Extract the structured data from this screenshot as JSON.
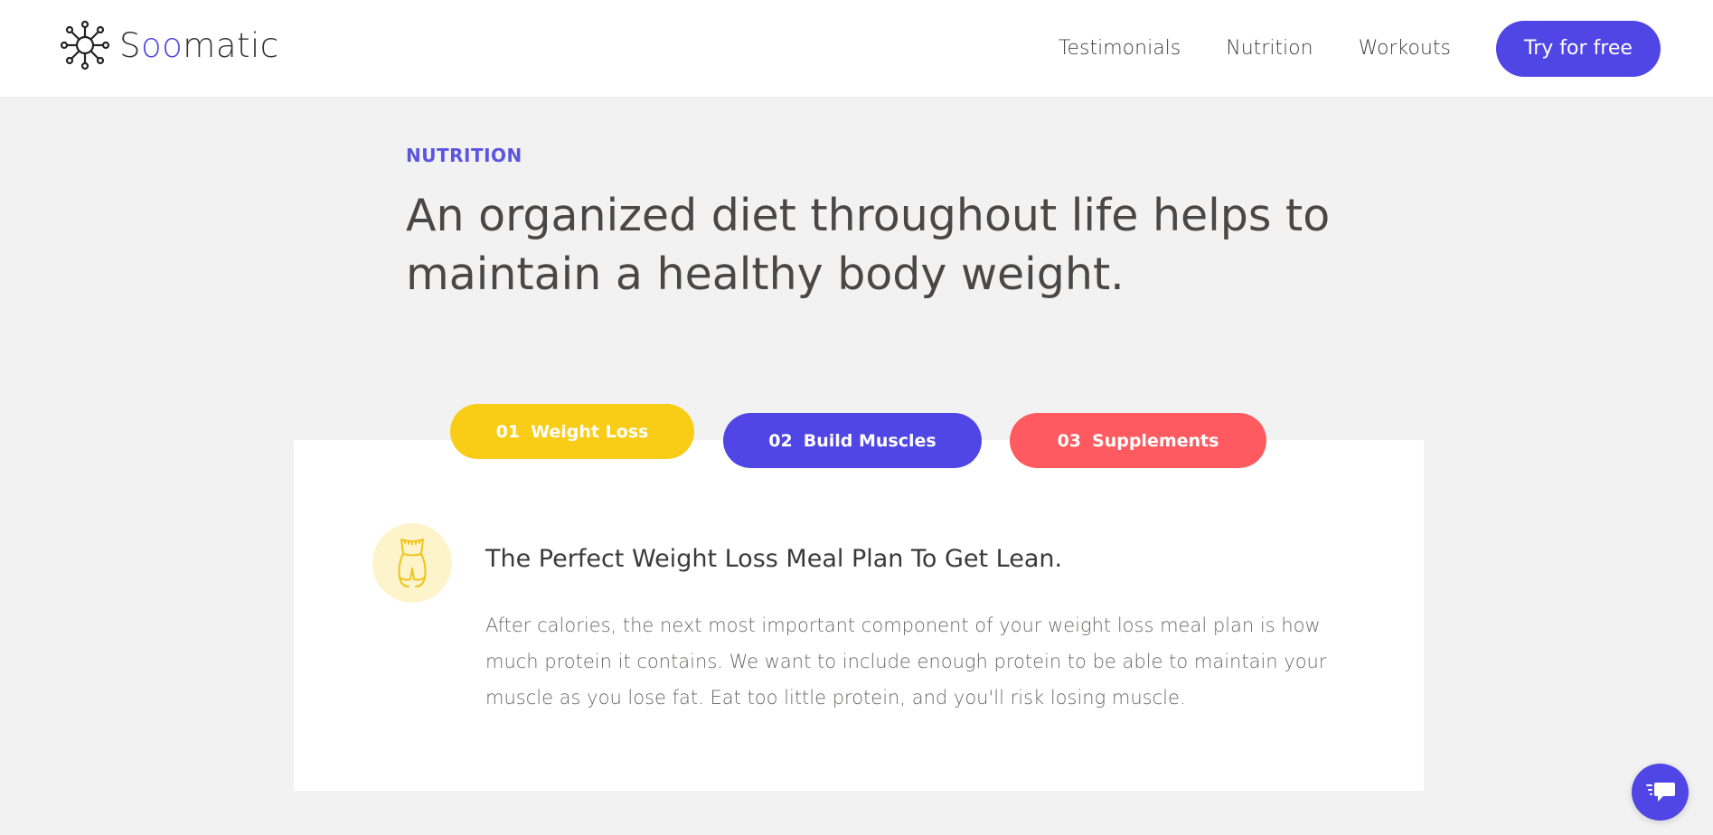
{
  "header": {
    "logo_text_before": "S",
    "logo_text_accent": "oo",
    "logo_text_after": "matic",
    "nav": [
      {
        "label": "Testimonials"
      },
      {
        "label": "Nutrition"
      },
      {
        "label": "Workouts"
      }
    ],
    "cta_label": "Try for free"
  },
  "hero": {
    "eyebrow": "NUTRITION",
    "headline": "An organized diet throughout life helps to maintain a healthy body weight."
  },
  "tabs": [
    {
      "num": "01",
      "label": "Weight Loss",
      "color": "#f9cc15"
    },
    {
      "num": "02",
      "label": "Build Muscles",
      "color": "#4f46e5"
    },
    {
      "num": "03",
      "label": "Supplements",
      "color": "#ff5a5f"
    }
  ],
  "feature": {
    "icon": "waist-measure-icon",
    "title": "The Perfect Weight Loss Meal Plan To Get Lean.",
    "body": "After calories, the next most important component of your weight loss meal plan is how much protein it contains. We want to include enough protein to be able to maintain your muscle as you lose fat. Eat too little protein, and you'll risk losing muscle."
  },
  "chat": {
    "icon": "chat-icon"
  },
  "colors": {
    "accent": "#4f46e5",
    "yellow": "#f9cc15",
    "red": "#ff5a5f"
  }
}
